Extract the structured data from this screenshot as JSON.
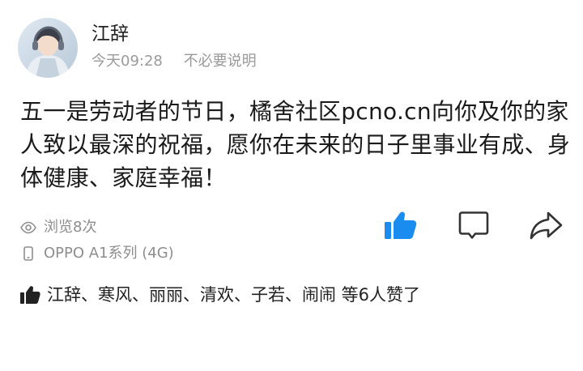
{
  "post": {
    "username": "江辞",
    "time": "今天09:28",
    "subtitle": "不必要说明",
    "content": "五一是劳动者的节日，橘舍社区pcno.cn向你及你的家人致以最深的祝福，愿你在未来的日子里事业有成、身体健康、家庭幸福！",
    "views": "浏览8次",
    "device": "OPPO A1系列 (4G)",
    "likers_text": "江辞、寒风、丽丽、清欢、子若、闹闹 等6人赞了"
  },
  "actions": {
    "like_icon": "thumbs-up-icon",
    "comment_icon": "comment-icon",
    "share_icon": "share-icon"
  },
  "colors": {
    "accent": "#1a8cf0",
    "secondary_text": "#9a9a9a",
    "primary_text": "#1a1a1a"
  }
}
